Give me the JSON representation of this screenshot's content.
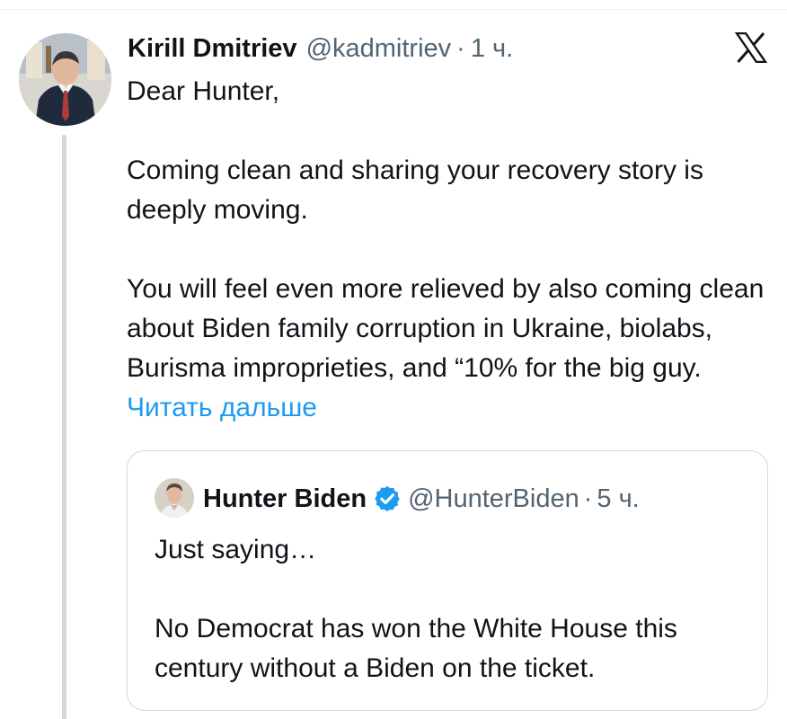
{
  "tweet": {
    "author_name": "Kirill Dmitriev",
    "author_handle": "@kadmitriev",
    "separator": "·",
    "time": "1 ч.",
    "paragraphs": [
      "Dear Hunter,",
      "Coming clean and sharing your recovery story is deeply moving.",
      "You will feel even more relieved by also coming clean about Biden family corruption in Ukraine, biolabs, Burisma improprieties, and “10% for the big guy."
    ],
    "read_more": "Читать дальше",
    "platform_icon": "x-logo-icon"
  },
  "quoted_tweet": {
    "author_name": "Hunter Biden",
    "verified": true,
    "author_handle": "@HunterBiden",
    "separator": "·",
    "time": "5 ч.",
    "paragraphs": [
      "Just saying…",
      "No Democrat has won the White House this century without a Biden on the ticket."
    ]
  },
  "colors": {
    "text_primary": "#0f1419",
    "text_secondary": "#536471",
    "link": "#1d9bf0",
    "border": "#cfd9de",
    "verified_badge": "#1d9bf0"
  }
}
